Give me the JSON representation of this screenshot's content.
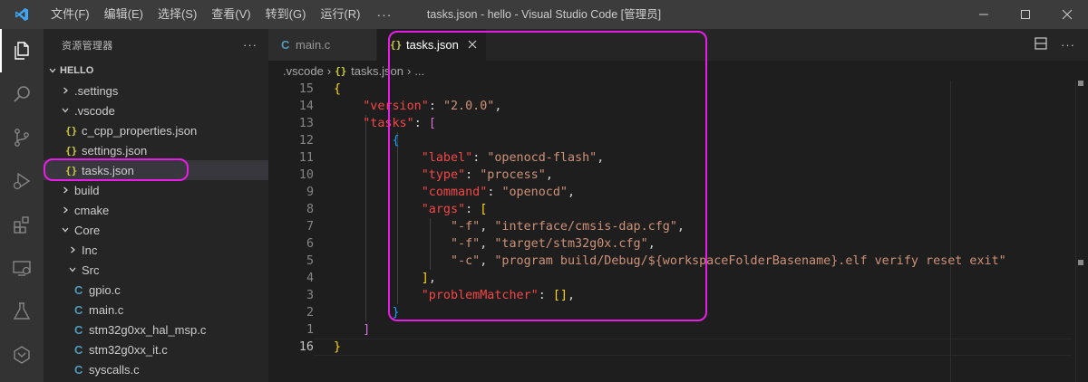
{
  "titlebar": {
    "menu": [
      "文件(F)",
      "编辑(E)",
      "选择(S)",
      "查看(V)",
      "转到(G)",
      "运行(R)"
    ],
    "more": "···",
    "title": "tasks.json - hello - Visual Studio Code [管理员]"
  },
  "sidebar": {
    "title": "资源管理器",
    "more": "···",
    "section": "HELLO",
    "items": [
      {
        "label": ".settings"
      },
      {
        "label": ".vscode"
      },
      {
        "label": "c_cpp_properties.json"
      },
      {
        "label": "settings.json"
      },
      {
        "label": "tasks.json"
      },
      {
        "label": "build"
      },
      {
        "label": "cmake"
      },
      {
        "label": "Core"
      },
      {
        "label": "Inc"
      },
      {
        "label": "Src"
      },
      {
        "label": "gpio.c"
      },
      {
        "label": "main.c"
      },
      {
        "label": "stm32g0xx_hal_msp.c"
      },
      {
        "label": "stm32g0xx_it.c"
      },
      {
        "label": "syscalls.c"
      }
    ]
  },
  "tabs": [
    {
      "label": "main.c"
    },
    {
      "label": "tasks.json"
    }
  ],
  "breadcrumb": [
    ".vscode",
    "tasks.json",
    "..."
  ],
  "editor": {
    "line_numbers": [
      "15",
      "14",
      "13",
      "12",
      "11",
      "10",
      "9",
      "8",
      "7",
      "6",
      "5",
      "4",
      "3",
      "2",
      "1",
      "16"
    ]
  },
  "colors": {
    "highlight": "#e81ee8",
    "accent": "#0078d4"
  }
}
